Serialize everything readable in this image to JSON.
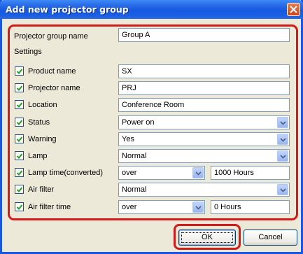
{
  "dialog": {
    "title": "Add new projector group",
    "close_icon": "close-icon"
  },
  "group": {
    "name_label": "Projector group name",
    "name_value": "Group A",
    "settings_label": "Settings"
  },
  "rows": [
    {
      "label": "Product name",
      "checked": true,
      "control": "text",
      "value": "SX"
    },
    {
      "label": "Projector name",
      "checked": true,
      "control": "text",
      "value": "PRJ"
    },
    {
      "label": "Location",
      "checked": true,
      "control": "text",
      "value": "Conference Room"
    },
    {
      "label": "Status",
      "checked": true,
      "control": "select",
      "value": "Power on"
    },
    {
      "label": "Warning",
      "checked": true,
      "control": "select",
      "value": "Yes"
    },
    {
      "label": "Lamp",
      "checked": true,
      "control": "select",
      "value": "Normal"
    },
    {
      "label": "Lamp time(converted)",
      "checked": true,
      "control": "select+text",
      "value": "over",
      "extra": "1000 Hours"
    },
    {
      "label": "Air filter",
      "checked": true,
      "control": "select",
      "value": "Normal"
    },
    {
      "label": "Air filter time",
      "checked": true,
      "control": "select+text",
      "value": "over",
      "extra": "0 Hours"
    }
  ],
  "buttons": {
    "ok": "OK",
    "cancel": "Cancel"
  },
  "colors": {
    "titlebar": "#1659e2",
    "highlight": "#d11a1a",
    "dialog_bg": "#ece9d8"
  }
}
